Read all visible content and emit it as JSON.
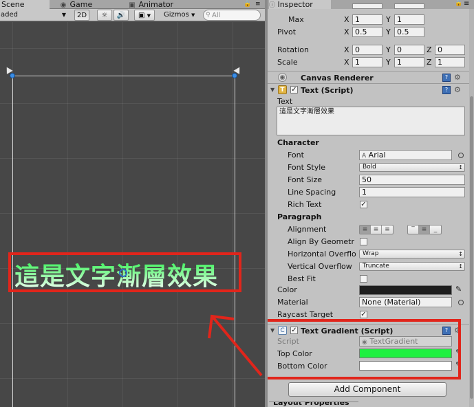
{
  "scene_panel": {
    "tabs": [
      {
        "label": "Scene",
        "icon": "scene-icon",
        "active": true
      },
      {
        "label": "Game",
        "icon": "game-icon",
        "active": false
      },
      {
        "label": "Animator",
        "icon": "animator-icon",
        "active": false
      }
    ],
    "toolbar": {
      "shading_mode": "aded",
      "mode_2d": "2D",
      "lighting_icon": "sun-icon",
      "audio_icon": "speaker-icon",
      "effects_icon": "image-icon",
      "gizmos": "Gizmos",
      "search_placeholder": "All"
    },
    "rendered_text": "這是文字漸層效果"
  },
  "inspector": {
    "tab": "Inspector",
    "rect_transform": {
      "max_label": "Max",
      "max_x": "1",
      "max_y": "1",
      "pivot_label": "Pivot",
      "pivot_x": "0.5",
      "pivot_y": "0.5",
      "rotation_label": "Rotation",
      "rot_x": "0",
      "rot_y": "0",
      "rot_z": "0",
      "scale_label": "Scale",
      "scale_x": "1",
      "scale_y": "1",
      "scale_z": "1",
      "axis_x": "X",
      "axis_y": "Y",
      "axis_z": "Z"
    },
    "canvas_renderer": {
      "title": "Canvas Renderer"
    },
    "text_script": {
      "title": "Text (Script)",
      "text_label": "Text",
      "text_value": "這是文字漸層效果",
      "character_header": "Character",
      "font_label": "Font",
      "font_value": "Arial",
      "font_style_label": "Font Style",
      "font_style_value": "Bold",
      "font_size_label": "Font Size",
      "font_size_value": "50",
      "line_spacing_label": "Line Spacing",
      "line_spacing_value": "1",
      "rich_text_label": "Rich Text",
      "rich_text_checked": true,
      "paragraph_header": "Paragraph",
      "alignment_label": "Alignment",
      "align_by_geometry_label": "Align By Geometr",
      "h_overflow_label": "Horizontal Overflo",
      "h_overflow_value": "Wrap",
      "v_overflow_label": "Vertical Overflow",
      "v_overflow_value": "Truncate",
      "best_fit_label": "Best Fit",
      "color_label": "Color",
      "color_value": "#1e1e1e",
      "material_label": "Material",
      "material_value": "None (Material)",
      "raycast_label": "Raycast Target",
      "raycast_checked": true
    },
    "text_gradient": {
      "title": "Text Gradient (Script)",
      "script_label": "Script",
      "script_value": "TextGradient",
      "top_color_label": "Top Color",
      "top_color": "#1ef040",
      "bottom_color_label": "Bottom Color",
      "bottom_color": "#ffffff"
    },
    "add_component": "Add Component",
    "layout_properties": "Layout Properties"
  },
  "annotation": {
    "highlight_color": "#e1251b"
  }
}
